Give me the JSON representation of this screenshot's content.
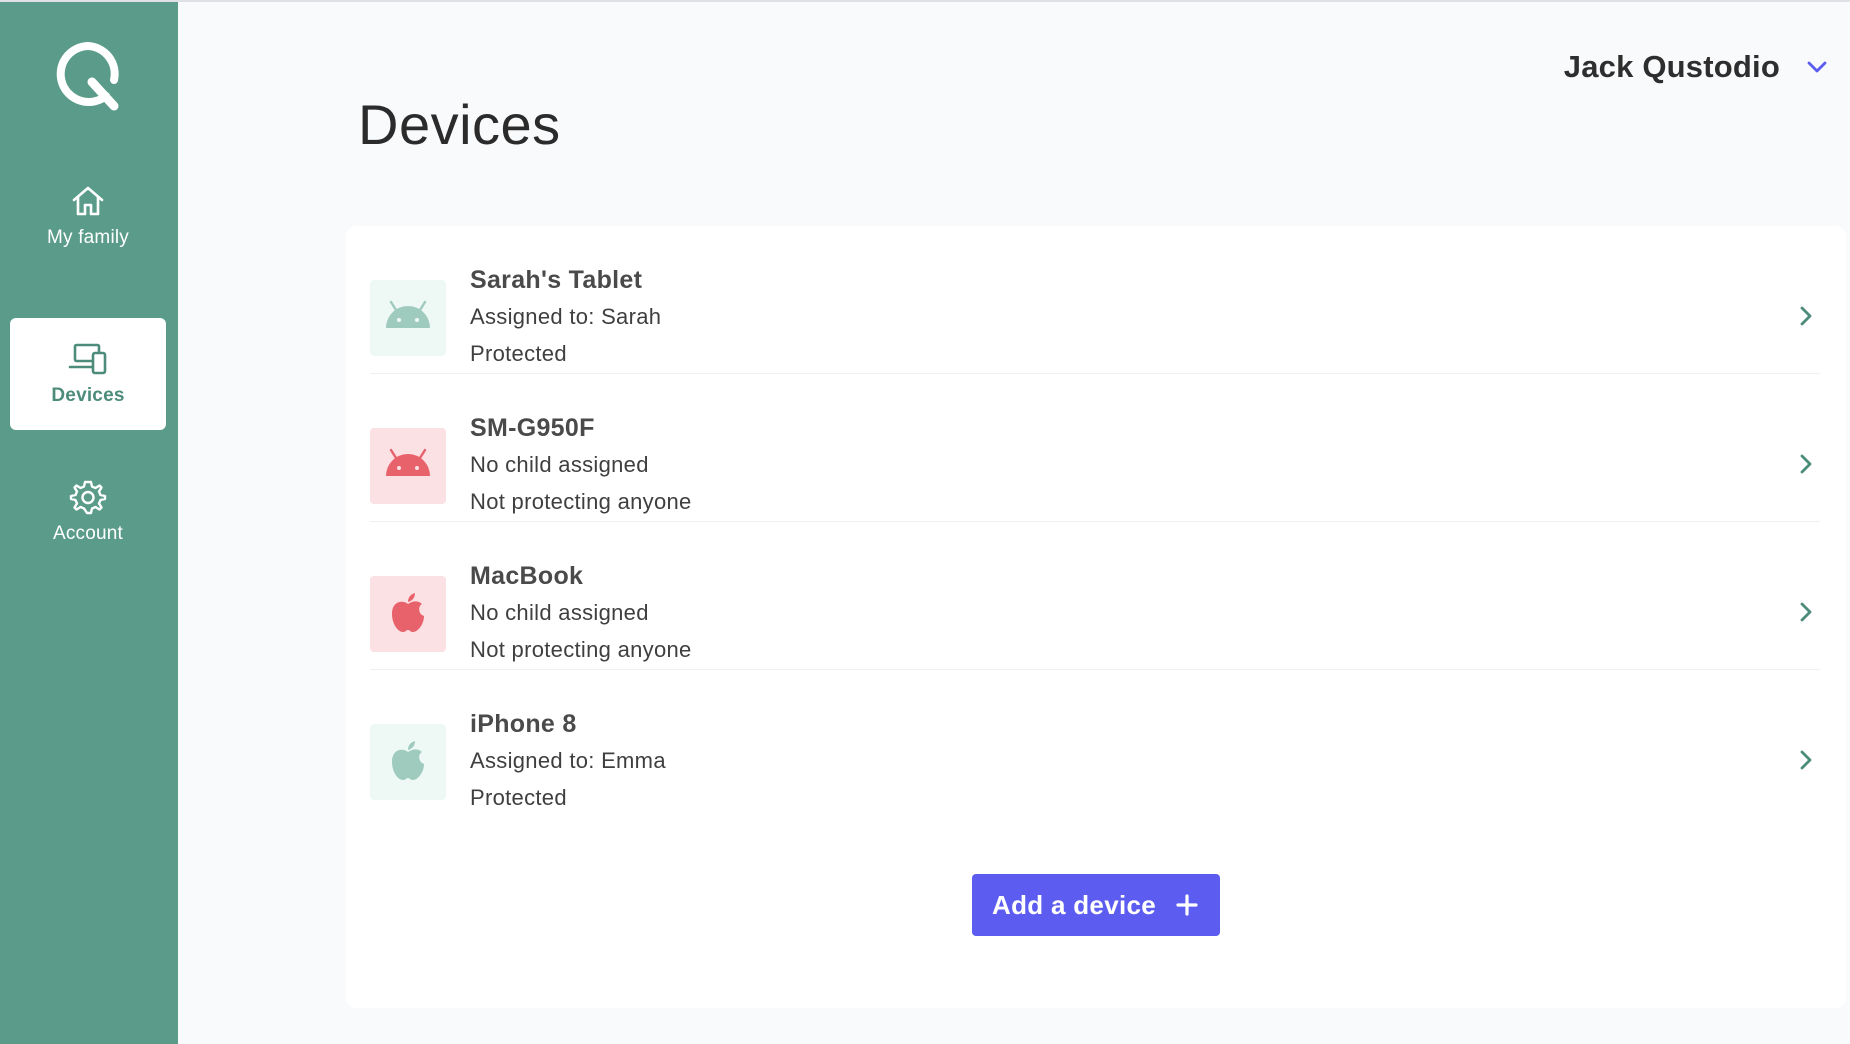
{
  "colors": {
    "sidebar": "#5a9c89",
    "accent": "#5c5cf0",
    "protected_bg": "#eef8f5",
    "protected_icon": "#9fcbbe",
    "unprotected_bg": "#fbe1e3",
    "unprotected_icon": "#e8626c"
  },
  "sidebar": {
    "logo": "qustodio-logo",
    "items": [
      {
        "label": "My family",
        "icon": "home-icon",
        "active": false
      },
      {
        "label": "Devices",
        "icon": "devices-icon",
        "active": true
      },
      {
        "label": "Account",
        "icon": "gear-icon",
        "active": false
      }
    ]
  },
  "header": {
    "user_name": "Jack Qustodio",
    "user_menu_icon": "chevron-down-icon"
  },
  "page": {
    "title": "Devices"
  },
  "devices": [
    {
      "name": "Sarah's Tablet",
      "assignment": "Assigned to: Sarah",
      "status": "Protected",
      "platform": "android-icon",
      "protected": true
    },
    {
      "name": "SM-G950F",
      "assignment": "No child assigned",
      "status": "Not protecting anyone",
      "platform": "android-icon",
      "protected": false
    },
    {
      "name": "MacBook",
      "assignment": "No child assigned",
      "status": "Not protecting anyone",
      "platform": "apple-icon",
      "protected": false
    },
    {
      "name": "iPhone 8",
      "assignment": "Assigned to: Emma",
      "status": "Protected",
      "platform": "apple-icon",
      "protected": true
    }
  ],
  "actions": {
    "add_device_label": "Add a device"
  }
}
